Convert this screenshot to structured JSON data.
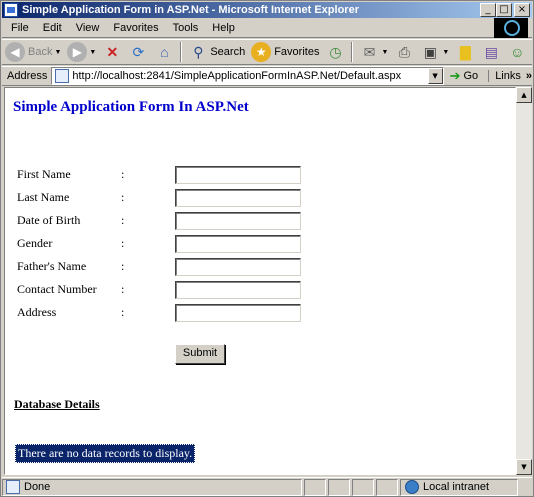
{
  "window": {
    "title": "Simple Application Form in ASP.Net - Microsoft Internet Explorer",
    "minimize_glyph": "_",
    "maximize_glyph": "□",
    "close_glyph": "×"
  },
  "menu": {
    "items": [
      "File",
      "Edit",
      "View",
      "Favorites",
      "Tools",
      "Help"
    ]
  },
  "toolbar": {
    "back_label": "Back",
    "search_label": "Search",
    "favorites_label": "Favorites"
  },
  "address": {
    "label": "Address",
    "url": "http://localhost:2841/SimpleApplicationFormInASP.Net/Default.aspx",
    "go_label": "Go",
    "links_label": "Links"
  },
  "page": {
    "title": "Simple Application Form In ASP.Net",
    "fields": [
      {
        "label": "First Name",
        "colon": ":",
        "value": ""
      },
      {
        "label": "Last Name",
        "colon": ":",
        "value": ""
      },
      {
        "label": "Date of Birth",
        "colon": ":",
        "value": ""
      },
      {
        "label": "Gender",
        "colon": ":",
        "value": ""
      },
      {
        "label": "Father's Name",
        "colon": ":",
        "value": ""
      },
      {
        "label": "Contact Number",
        "colon": ":",
        "value": ""
      },
      {
        "label": "Address",
        "colon": ":",
        "value": ""
      }
    ],
    "submit_label": "Submit",
    "database_heading": "Database Details",
    "empty_message": "There are no data records to display."
  },
  "status": {
    "text": "Done",
    "zone": "Local intranet"
  },
  "colors": {
    "title_blue": "#0000cc",
    "titlebar_start": "#0a246a",
    "selection_bg": "#0a246a"
  }
}
